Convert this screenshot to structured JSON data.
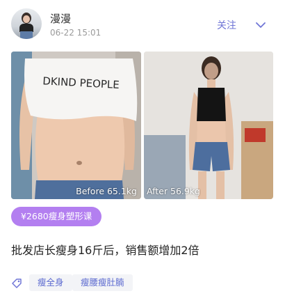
{
  "author": {
    "name": "漫漫",
    "timestamp": "06-22 15:01"
  },
  "header": {
    "follow_label": "关注",
    "menu_icon": "chevron-down-icon"
  },
  "photos": {
    "before_label": "Before 65.1kg",
    "after_label": "After 56.9kg",
    "before_shirt_text": "DKIND PEOPLE"
  },
  "course_tag": "¥2680瘦身塑形课",
  "post_text": "批发店长瘦身16斤后，销售额增加2倍",
  "topics": [
    "瘦全身",
    "瘦腰瘦肚腩"
  ],
  "colors": {
    "accent": "#6f75d6",
    "course_tag_bg": "#b37ff0",
    "topic_bg": "#f3f4f7",
    "topic_text": "#5c6ad0"
  }
}
